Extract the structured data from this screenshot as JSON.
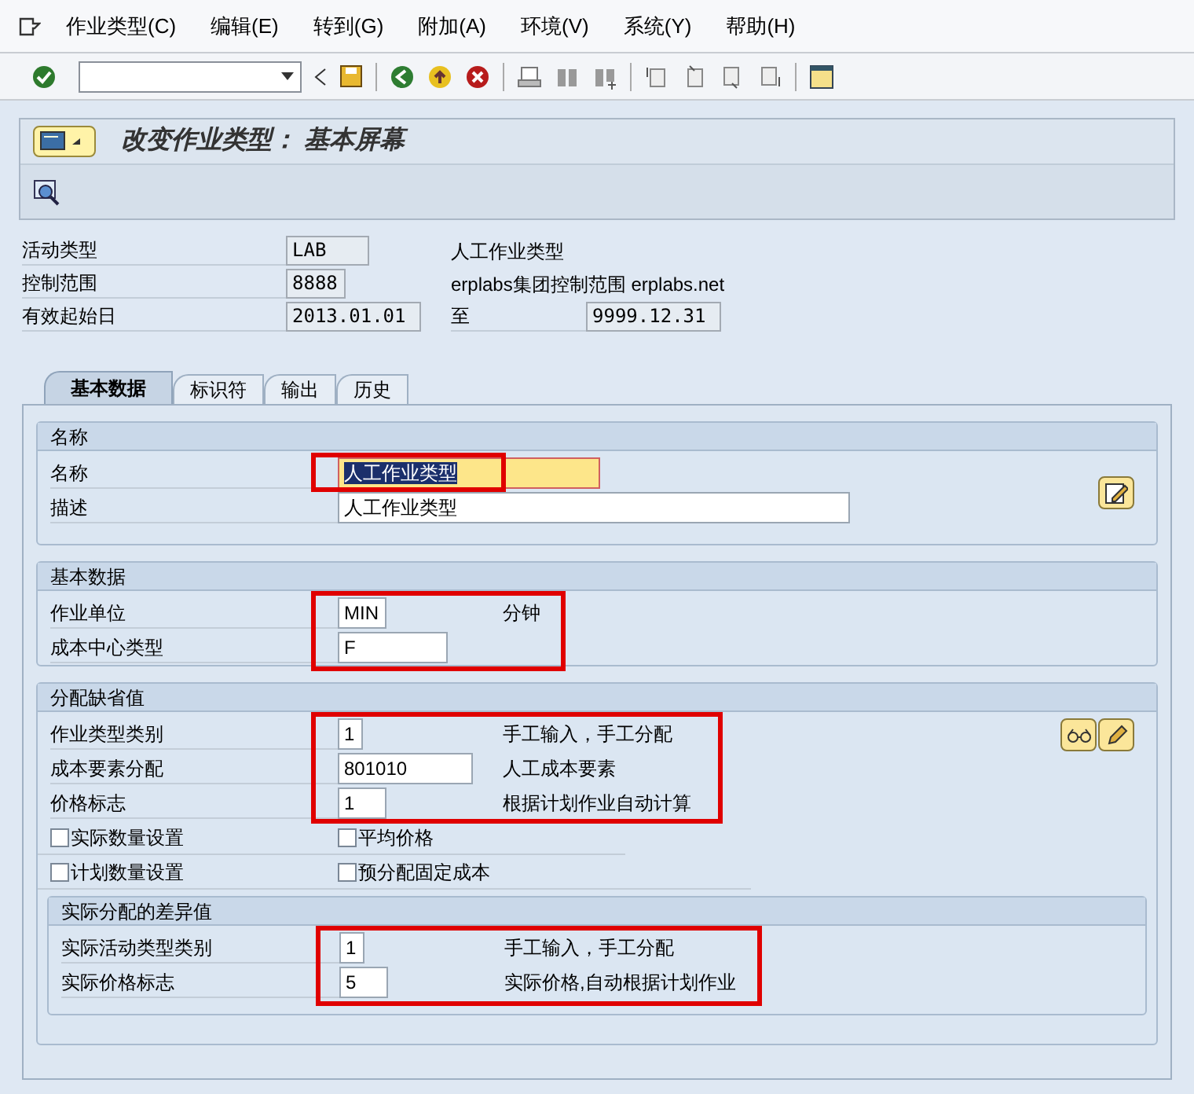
{
  "menu": [
    {
      "label": "作业类型(C)"
    },
    {
      "label": "编辑(E)"
    },
    {
      "label": "转到(G)"
    },
    {
      "label": "附加(A)"
    },
    {
      "label": "环境(V)"
    },
    {
      "label": "系统(Y)"
    },
    {
      "label": "帮助(H)"
    }
  ],
  "title": "改变作业类型： 基本屏幕",
  "header": [
    {
      "label": "活动类型",
      "value": "LAB",
      "description": "人工作业类型"
    },
    {
      "label": "控制范围",
      "value": "8888",
      "description": "erplabs集团控制范围 erplabs.net"
    },
    {
      "label": "有效起始日",
      "value": "2013.01.01",
      "to_label": "至",
      "to_value": "9999.12.31"
    }
  ],
  "tabs": [
    {
      "label": "基本数据",
      "selected": true
    },
    {
      "label": "标识符",
      "selected": false
    },
    {
      "label": "输出",
      "selected": false
    },
    {
      "label": "历史",
      "selected": false
    }
  ],
  "name_group": {
    "title": "名称",
    "fields": [
      {
        "label": "名称",
        "value": "人工作业类型",
        "focused": true
      },
      {
        "label": "描述",
        "value": "人工作业类型",
        "focused": false
      }
    ]
  },
  "basic_group": {
    "title": "基本数据",
    "fields": [
      {
        "label": "作业单位",
        "value": "MIN",
        "text": "分钟"
      },
      {
        "label": "成本中心类型",
        "value": "F"
      }
    ]
  },
  "defaults_group": {
    "title": "分配缺省值",
    "fields": [
      {
        "label": "作业类型类别",
        "value": "1",
        "text": "手工输入，手工分配"
      },
      {
        "label": "成本要素分配",
        "value": "801010",
        "text": "人工成本要素"
      },
      {
        "label": "价格标志",
        "value": "1",
        "text": "根据计划作业自动计算"
      }
    ],
    "checkboxes": [
      {
        "label": "实际数量设置",
        "checked": false
      },
      {
        "label": "平均价格",
        "checked": false
      },
      {
        "label": "计划数量设置",
        "checked": false
      },
      {
        "label": "预分配固定成本",
        "checked": false
      }
    ],
    "variance_group": {
      "title": "实际分配的差异值",
      "fields": [
        {
          "label": "实际活动类型类别",
          "value": "1",
          "text": "手工输入，手工分配"
        },
        {
          "label": "实际价格标志",
          "value": "5",
          "text": "实际价格,自动根据计划作业"
        }
      ]
    }
  }
}
